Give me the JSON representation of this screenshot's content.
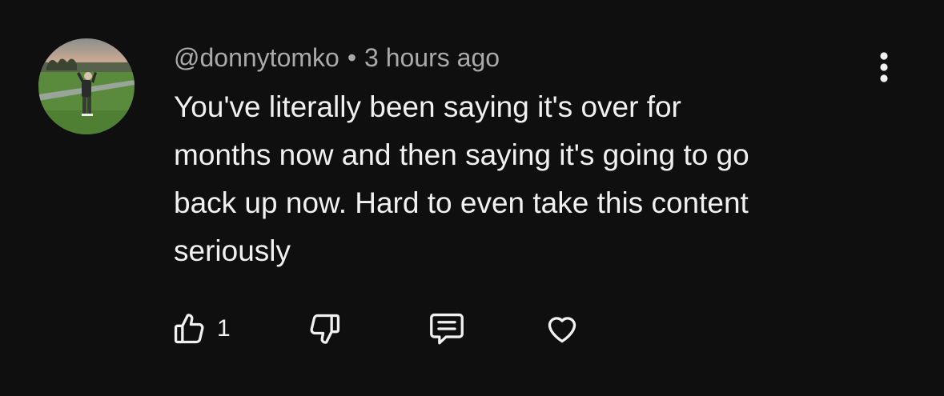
{
  "comment": {
    "author": "@donnytomko",
    "separator": "•",
    "timestamp": "3 hours ago",
    "text": "You've literally been saying it's over for\nmonths now and then saying it's going to go\nback up now. Hard to even take this content\nseriously",
    "like_count": "1"
  },
  "icons": {
    "like": "thumbs-up-icon",
    "dislike": "thumbs-down-icon",
    "reply": "comment-icon",
    "heart": "heart-icon",
    "more": "more-vertical-icon"
  },
  "colors": {
    "background": "#0f0f0f",
    "primary_text": "#f1f1f1",
    "secondary_text": "#aaaaaa"
  }
}
